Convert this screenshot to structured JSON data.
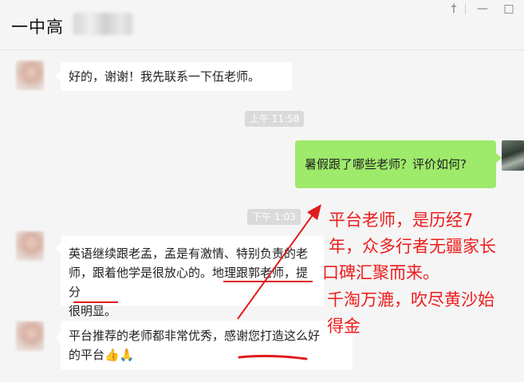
{
  "window": {
    "title": "一中高",
    "controls": {
      "pin": "†",
      "minimize": "—",
      "maximize": "□"
    }
  },
  "messages": [
    {
      "side": "left",
      "text": "好的，谢谢！我先联系一下伍老师。"
    },
    {
      "side": "timestamp",
      "text": "上午 11:58"
    },
    {
      "side": "right",
      "text": "暑假跟了哪些老师？评价如何?"
    },
    {
      "side": "timestamp",
      "text": "下午 1:03"
    },
    {
      "side": "left",
      "lines": [
        "英语继续跟老孟，孟是有激情、特别负责的老",
        "师，跟着他学是很放心的。地理跟郭老师，提分",
        "很明显。"
      ]
    },
    {
      "side": "left",
      "lines": [
        "平台推荐的老师都非常优秀，感谢您打造这么好",
        "的平台👍🙏"
      ]
    }
  ],
  "annotation": {
    "color": "#ee1c1c",
    "lines": [
      "平台老师，是历经7",
      "年，众多行者无疆家长",
      "口碑汇聚而来。",
      "千淘万漉，吹尽黄沙始",
      "得金"
    ]
  },
  "colors": {
    "self_bubble": "#9eea6a",
    "other_bubble": "#ffffff",
    "background": "#f5f5f5"
  }
}
